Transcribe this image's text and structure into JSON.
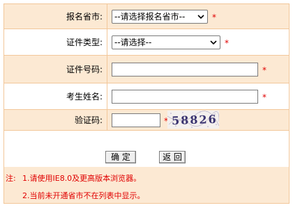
{
  "form": {
    "province": {
      "label": "报名省市:",
      "selected": "--请选择报名省市--",
      "required_mark": "*"
    },
    "id_type": {
      "label": "证件类型:",
      "selected": "--请选择--",
      "required_mark": "*"
    },
    "id_number": {
      "label": "证件号码:",
      "value": "",
      "required_mark": "*"
    },
    "name": {
      "label": "考生姓名:",
      "value": "",
      "required_mark": "*"
    },
    "captcha": {
      "label": "验证码:",
      "value": "",
      "required_mark": "*",
      "image_text": "58826"
    },
    "buttons": {
      "confirm": "确 定",
      "back": "返 回"
    }
  },
  "notes": {
    "prefix": "注:",
    "line1": "1.请使用IE8.0及更高版本浏览器。",
    "line2": "2.当前未开通省市不在列表中显示。"
  },
  "colors": {
    "border": "#f2c79a",
    "shade": "#fce9d3",
    "required": "#e00000"
  }
}
